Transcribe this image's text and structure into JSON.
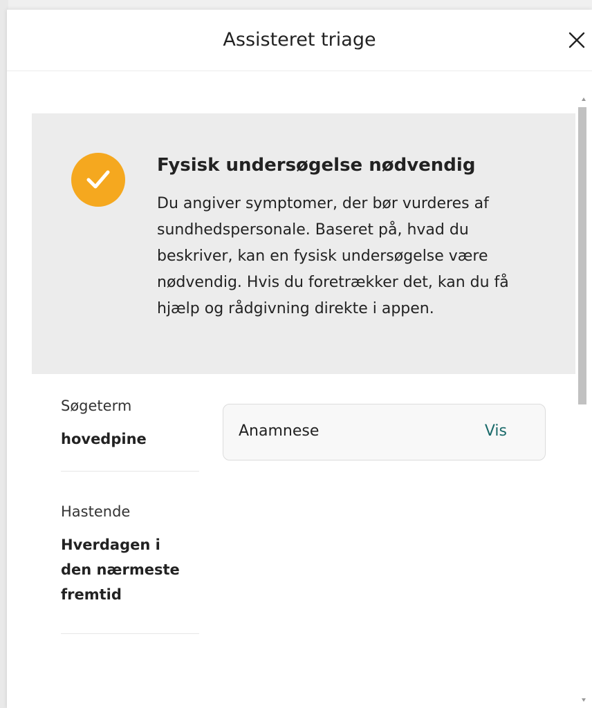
{
  "modal": {
    "title": "Assisteret triage",
    "close_icon": "close-icon"
  },
  "result": {
    "icon": "check-icon",
    "icon_color": "#f5a81f",
    "title": "Fysisk undersøgelse nødvendig",
    "text": "Du angiver symptomer, der bør vurderes af sundhedspersonale. Baseret på, hvad du beskriver, kan en fysisk undersøgelse være nødvendig. Hvis du foretrækker det, kan du få hjælp og rådgivning direkte i appen."
  },
  "details": [
    {
      "label": "Søgeterm",
      "value": "hovedpine"
    },
    {
      "label": "Hastende",
      "value": "Hverdagen i den nærmeste fremtid"
    }
  ],
  "anamnese": {
    "label": "Anamnese",
    "action": "Vis",
    "action_color": "#1a6a6a"
  },
  "scrollbar": {
    "position_fraction": 0.0
  }
}
